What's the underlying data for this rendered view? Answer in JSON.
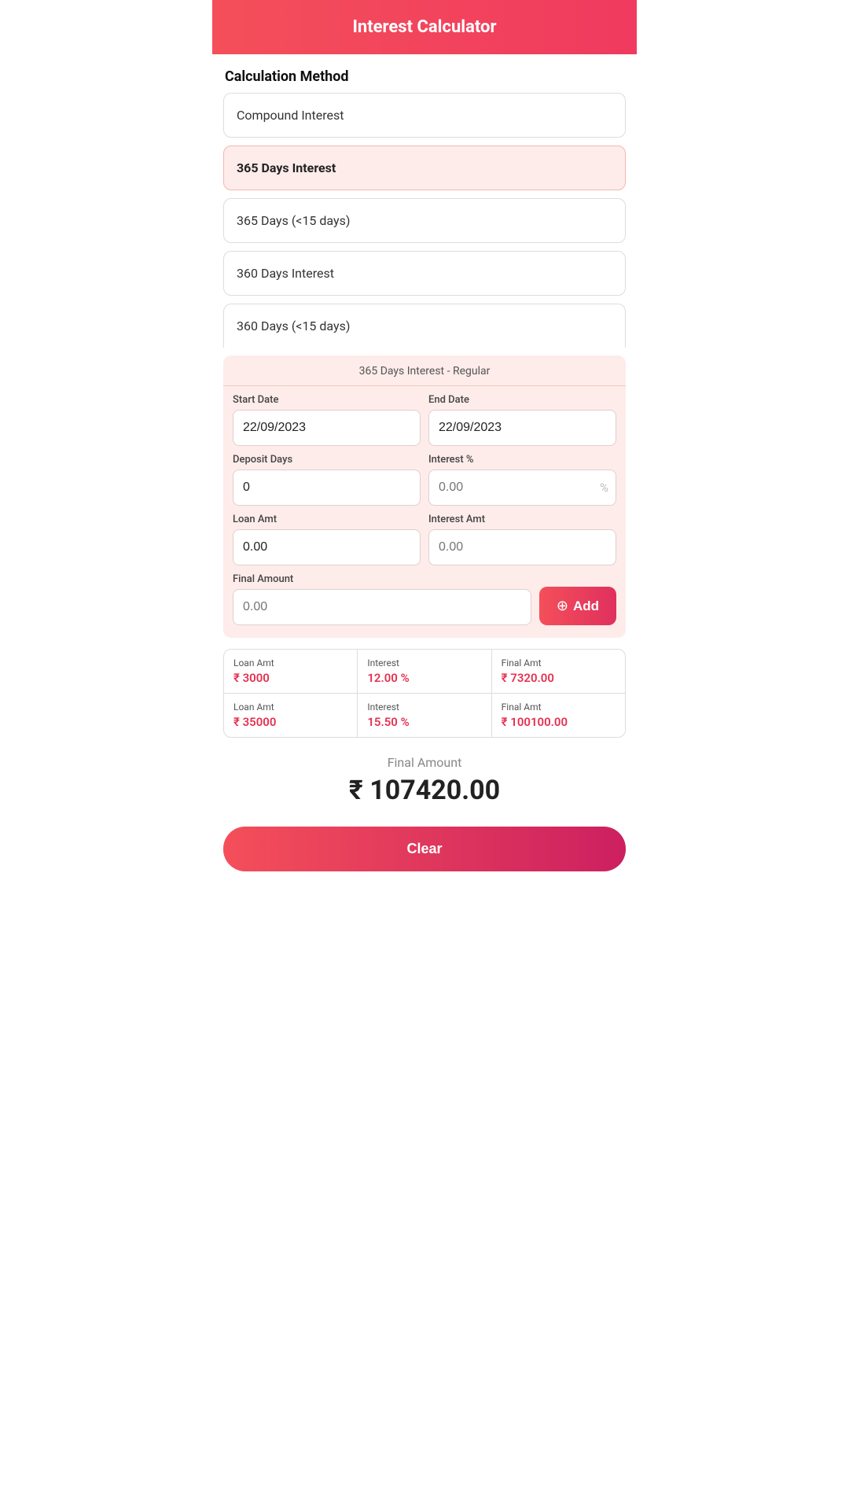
{
  "header": {
    "title": "Interest Calculator"
  },
  "calculation_method": {
    "section_label": "Calculation Method",
    "methods": [
      {
        "id": "compound",
        "label": "Compound Interest",
        "selected": false
      },
      {
        "id": "365days",
        "label": "365 Days Interest",
        "selected": true
      },
      {
        "id": "365days_lt15",
        "label": "365 Days (<15 days)",
        "selected": false
      },
      {
        "id": "360days",
        "label": "360 Days Interest",
        "selected": false
      },
      {
        "id": "360days_lt15",
        "label": "360 Days (<15 days)",
        "selected": false
      }
    ]
  },
  "calculator": {
    "subtitle": "365 Days Interest - Regular",
    "start_date_label": "Start Date",
    "start_date_value": "22/09/2023",
    "end_date_label": "End Date",
    "end_date_value": "22/09/2023",
    "deposit_days_label": "Deposit Days",
    "deposit_days_value": "0",
    "interest_pct_label": "Interest %",
    "interest_pct_placeholder": "0.00",
    "interest_pct_suffix": "%",
    "loan_amt_label": "Loan Amt",
    "loan_amt_value": "0.00",
    "interest_amt_label": "Interest Amt",
    "interest_amt_placeholder": "0.00",
    "final_amount_label": "Final Amount",
    "final_amount_placeholder": "0.00",
    "add_button_label": "Add",
    "add_button_icon": "⊕"
  },
  "results": {
    "rows": [
      {
        "loan_amt_label": "Loan Amt",
        "loan_amt_value": "₹ 3000",
        "interest_label": "Interest",
        "interest_value": "12.00 %",
        "final_amt_label": "Final Amt",
        "final_amt_value": "₹ 7320.00"
      },
      {
        "loan_amt_label": "Loan Amt",
        "loan_amt_value": "₹ 35000",
        "interest_label": "Interest",
        "interest_value": "15.50 %",
        "final_amt_label": "Final Amt",
        "final_amt_value": "₹ 100100.00"
      }
    ]
  },
  "summary": {
    "final_amount_label": "Final Amount",
    "final_amount_value": "₹ 107420.00"
  },
  "clear_button_label": "Clear"
}
